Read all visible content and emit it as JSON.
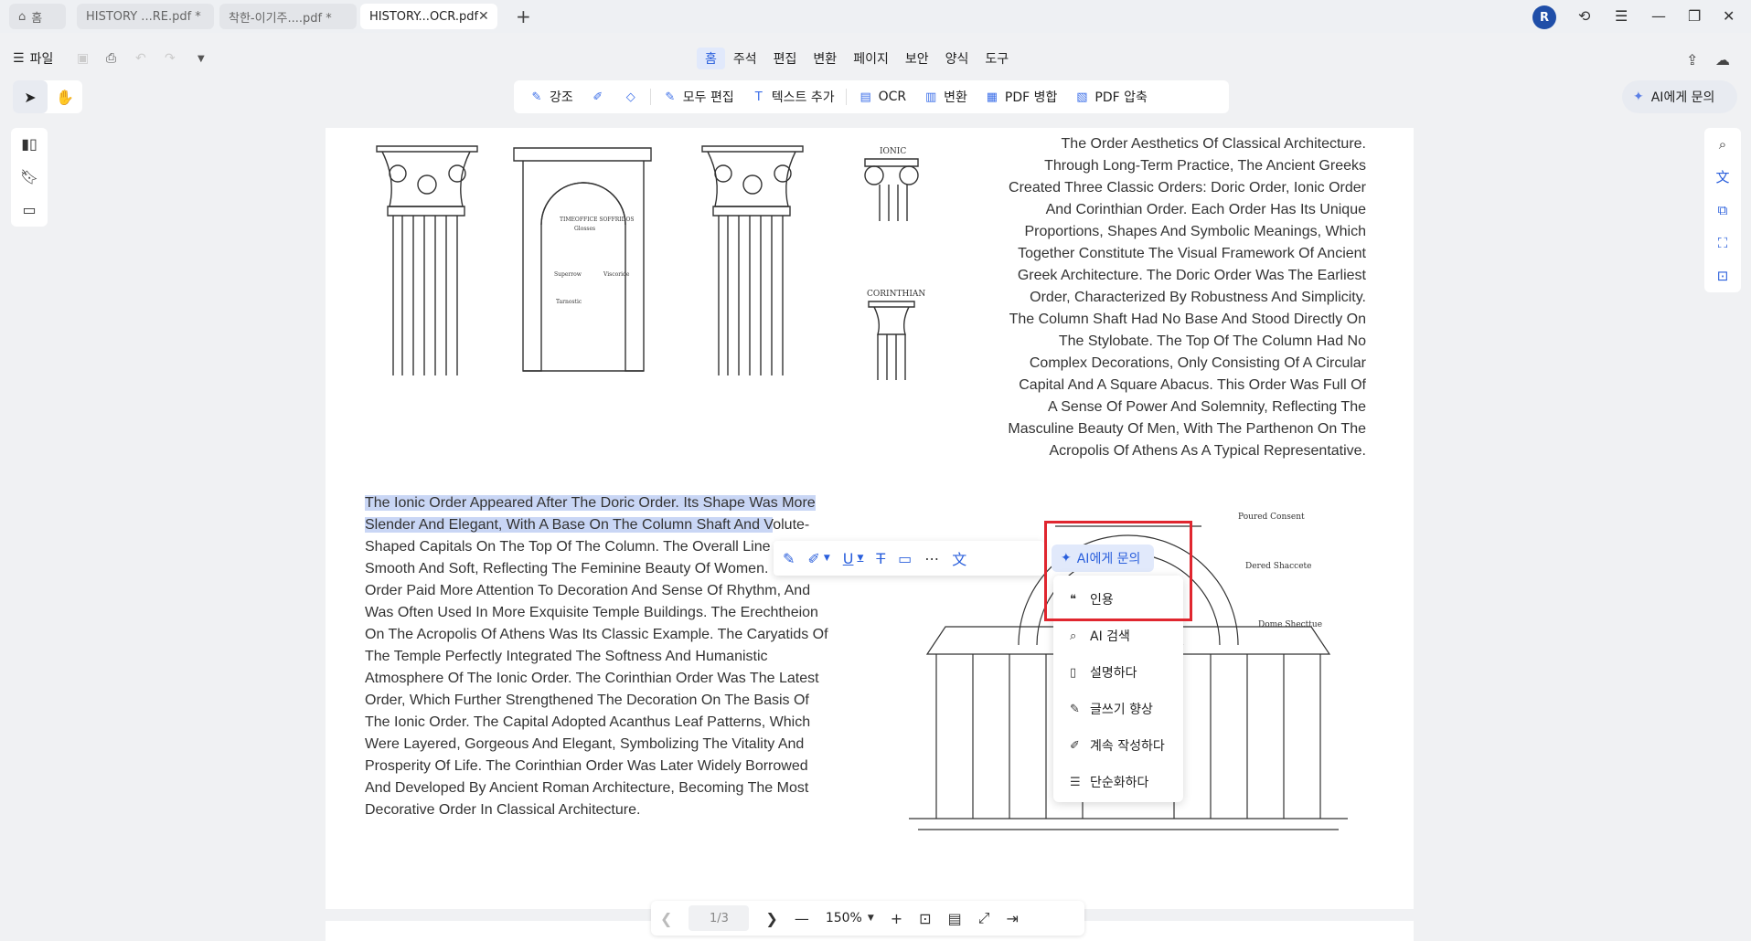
{
  "tabs": {
    "home": "홈",
    "tab1": "HISTORY ...RE.pdf *",
    "tab2": "착한-이기주....pdf *",
    "tab3": "HISTORY...OCR.pdf"
  },
  "user": {
    "avatar_letter": "R"
  },
  "menu": {
    "file": "파일",
    "items": [
      "홈",
      "주석",
      "편집",
      "변환",
      "페이지",
      "보안",
      "양식",
      "도구"
    ]
  },
  "toolbar": {
    "highlight": "강조",
    "edit_all": "모두 편집",
    "add_text": "텍스트 추가",
    "ocr": "OCR",
    "convert": "변환",
    "merge": "PDF 병합",
    "compress": "PDF 압축"
  },
  "ai_button": "AI에게 문의",
  "figures": {
    "ionic": "IONIC",
    "corinthian": "CORINTHIAN",
    "arch_caption_1": "TIMEOFFICE SOFFRIDOS",
    "arch_caption_2": "Glosses",
    "arch_caption_3": "Superrow",
    "arch_caption_4": "Viscoride",
    "arch_caption_5": "Tarnostic",
    "dome_label_1": "Poured Consent",
    "dome_label_2": "Dered Shaccete",
    "dome_label_3": "Dome Shecttue"
  },
  "text_right": [
    "The Order Aesthetics Of Classical Architecture.",
    "Through Long-Term Practice, The Ancient Greeks",
    "Created Three Classic Orders: Doric Order, Ionic Order",
    "And Corinthian Order. Each Order Has Its Unique",
    "Proportions, Shapes And Symbolic Meanings, Which",
    "Together Constitute The Visual Framework Of Ancient",
    "Greek Architecture. The Doric Order Was The Earliest",
    "Order, Characterized By Robustness And Simplicity.",
    "The Column Shaft Had No Base And Stood Directly On",
    "The Stylobate. The Top Of The Column Had No",
    "Complex Decorations, Only Consisting Of A Circular",
    "Capital And A Square Abacus. This Order Was Full Of",
    "A Sense Of Power And Solemnity, Reflecting The",
    "Masculine Beauty Of Men, With The Parthenon On The",
    "Acropolis Of Athens As A Typical Representative."
  ],
  "text_left_highlight": [
    "The Ionic Order Appeared After The Doric Order. Its Shape Was More",
    "Slender And Elegant, With A Base On The Column Shaft And V"
  ],
  "text_left_tail": "olute-",
  "text_left": [
    "Shaped Capitals On The Top Of The Column. The Overall Line",
    "Smooth And Soft, Reflecting The Feminine Beauty Of Women.",
    "Order Paid More Attention To Decoration And Sense Of Rhythm, And",
    "Was Often Used In More Exquisite Temple Buildings. The Erechtheion",
    "On The Acropolis Of Athens Was Its Classic Example. The Caryatids Of",
    "The Temple Perfectly Integrated The Softness And Humanistic",
    "Atmosphere Of The Ionic Order. The Corinthian Order Was The Latest",
    "Order, Which Further Strengthened The Decoration On The Basis Of",
    "The Ionic Order. The Capital Adopted Acanthus Leaf Patterns, Which",
    "Were Layered, Gorgeous And Elegant, Symbolizing The Vitality And",
    "Prosperity Of Life. The Corinthian Order Was Later Widely Borrowed",
    "And Developed By Ancient Roman Architecture, Becoming The Most",
    "Decorative Order In Classical Architecture."
  ],
  "ai_popup": {
    "title": "AI에게 문의",
    "items": [
      "인용",
      "AI 검색",
      "설명하다",
      "글쓰기 향상",
      "계속 작성하다",
      "단순화하다"
    ]
  },
  "nav": {
    "page": "1/3",
    "zoom": "150%"
  },
  "colors": {
    "accent": "#2a5fdc",
    "highlight": "#c9d6f5",
    "callout": "#e0262f"
  }
}
